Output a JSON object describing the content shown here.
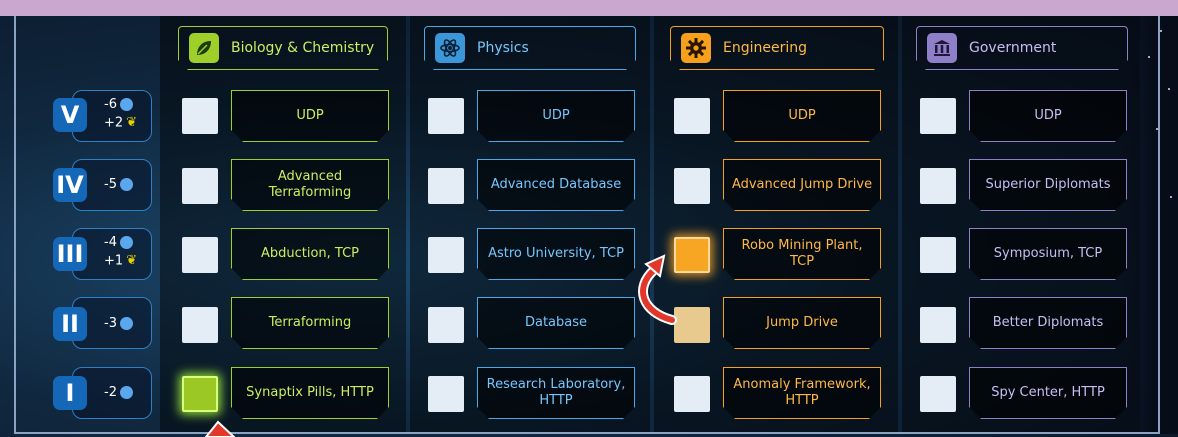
{
  "headers": [
    {
      "label": "Biology & Chemistry",
      "icon": "leaf-icon",
      "color": "#9fcf2a"
    },
    {
      "label": "Physics",
      "icon": "atom-icon",
      "color": "#4aa8e6"
    },
    {
      "label": "Engineering",
      "icon": "gear-icon",
      "color": "#f5a11e"
    },
    {
      "label": "Government",
      "icon": "building-icon",
      "color": "#8f7fc9"
    }
  ],
  "rows": [
    {
      "roman": "V",
      "cost": "-6",
      "bonus": "+2"
    },
    {
      "roman": "IV",
      "cost": "-5",
      "bonus": ""
    },
    {
      "roman": "III",
      "cost": "-4",
      "bonus": "+1"
    },
    {
      "roman": "II",
      "cost": "-3",
      "bonus": ""
    },
    {
      "roman": "I",
      "cost": "-2",
      "bonus": ""
    }
  ],
  "cards": {
    "bio": [
      "UDP",
      "Advanced Terraforming",
      "Abduction, TCP",
      "Terraforming",
      "Synaptix Pills, HTTP"
    ],
    "phy": [
      "UDP",
      "Advanced Database",
      "Astro University, TCP",
      "Database",
      "Research Laboratory, HTTP"
    ],
    "eng": [
      "UDP",
      "Advanced Jump Drive",
      "Robo Mining Plant, TCP",
      "Jump Drive",
      "Anomaly Framework, HTTP"
    ],
    "gov": [
      "UDP",
      "Superior Diplomats",
      "Symposium, TCP",
      "Better Diplomats",
      "Spy Center, HTTP"
    ]
  },
  "box_states": {
    "bio": [
      "empty",
      "empty",
      "empty",
      "empty",
      "selected-green"
    ],
    "phy": [
      "empty",
      "empty",
      "empty",
      "empty",
      "empty"
    ],
    "eng": [
      "empty",
      "empty",
      "selected-orange",
      "previous-tan",
      "empty"
    ],
    "gov": [
      "empty",
      "empty",
      "empty",
      "empty",
      "empty"
    ]
  },
  "colors": {
    "accent_blue": "#1567b8",
    "flask": "#5aa7ee",
    "laurel": "#e8d000",
    "arrow": "#e2382a"
  }
}
